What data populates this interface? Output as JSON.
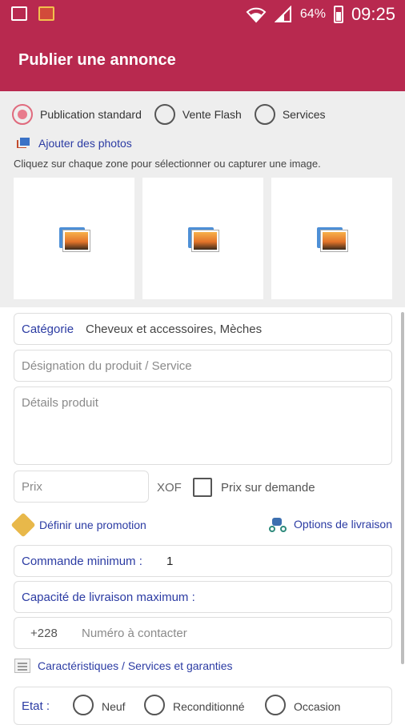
{
  "status_bar": {
    "battery_pct": "64%",
    "time": "09:25"
  },
  "app_bar": {
    "title": "Publier une annonce"
  },
  "publication_type": {
    "options": [
      "Publication standard",
      "Vente Flash",
      "Services"
    ],
    "selected": "Publication standard"
  },
  "photos": {
    "add_label": "Ajouter des photos",
    "hint": "Cliquez sur chaque zone pour sélectionner ou capturer une image.",
    "slots": 3
  },
  "form": {
    "category_label": "Catégorie",
    "category_value": "Cheveux et accessoires, Mèches",
    "designation_placeholder": "Désignation du produit / Service",
    "details_placeholder": "Détails produit",
    "price_placeholder": "Prix",
    "currency": "XOF",
    "price_on_request_label": "Prix sur demande",
    "promotion_label": "Définir une promotion",
    "delivery_options_label": "Options de livraison",
    "min_order_label": "Commande minimum :",
    "min_order_value": "1",
    "max_delivery_label": "Capacité de livraison maximum :",
    "phone_prefix": "+228",
    "phone_placeholder": "Numéro à contacter",
    "features_label": "Caractéristiques / Services et garanties",
    "condition_label": "Etat :",
    "condition_options": [
      "Neuf",
      "Reconditionné",
      "Occasion"
    ]
  },
  "colors": {
    "brand": "#b8294f",
    "link": "#2b3ba3",
    "radio_selected": "#e87b8c"
  }
}
